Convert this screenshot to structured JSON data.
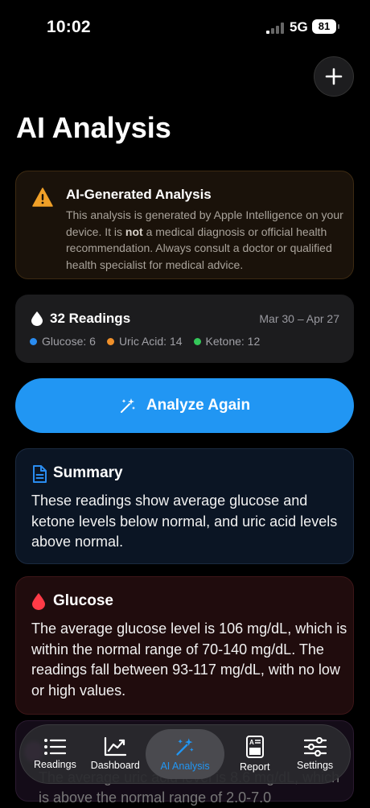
{
  "status": {
    "time": "10:02",
    "network": "5G",
    "battery": "81"
  },
  "page": {
    "title": "AI Analysis"
  },
  "notice": {
    "title": "AI-Generated Analysis",
    "body_before": "This analysis is generated by Apple Intelligence on your device. It is ",
    "body_bold": "not",
    "body_after": " a medical diagnosis or official health recommendation. Always consult a doctor or qualified health specialist for medical advice."
  },
  "readings": {
    "count_label": "32 Readings",
    "date_range": "Mar 30 – Apr 27",
    "legend": [
      {
        "label": "Glucose: 6",
        "color": "#2a8cf0"
      },
      {
        "label": "Uric Acid: 14",
        "color": "#f0902a"
      },
      {
        "label": "Ketone: 12",
        "color": "#34c759"
      }
    ]
  },
  "actions": {
    "analyze_label": "Analyze Again"
  },
  "summary": {
    "title": "Summary",
    "body": "These readings show average glucose and ketone levels below normal, and uric acid levels above normal."
  },
  "glucose": {
    "title": "Glucose",
    "body": "The average glucose level is 106 mg/dL, which is within the normal range of 70-140 mg/dL. The readings fall between 93-117 mg/dL, with no low or high values."
  },
  "next_card": {
    "body": "The average uric acid level is 8.6 mg/dL, which is above the normal range of 2.0-7.0"
  },
  "tabs": [
    {
      "label": "Readings",
      "icon": "list-icon"
    },
    {
      "label": "Dashboard",
      "icon": "chart-icon"
    },
    {
      "label": "AI Analysis",
      "icon": "sparkles-icon"
    },
    {
      "label": "Report",
      "icon": "report-icon"
    },
    {
      "label": "Settings",
      "icon": "sliders-icon"
    }
  ],
  "colors": {
    "accent": "#2196f3",
    "warning": "#f0a028",
    "danger": "#ff3b47"
  }
}
